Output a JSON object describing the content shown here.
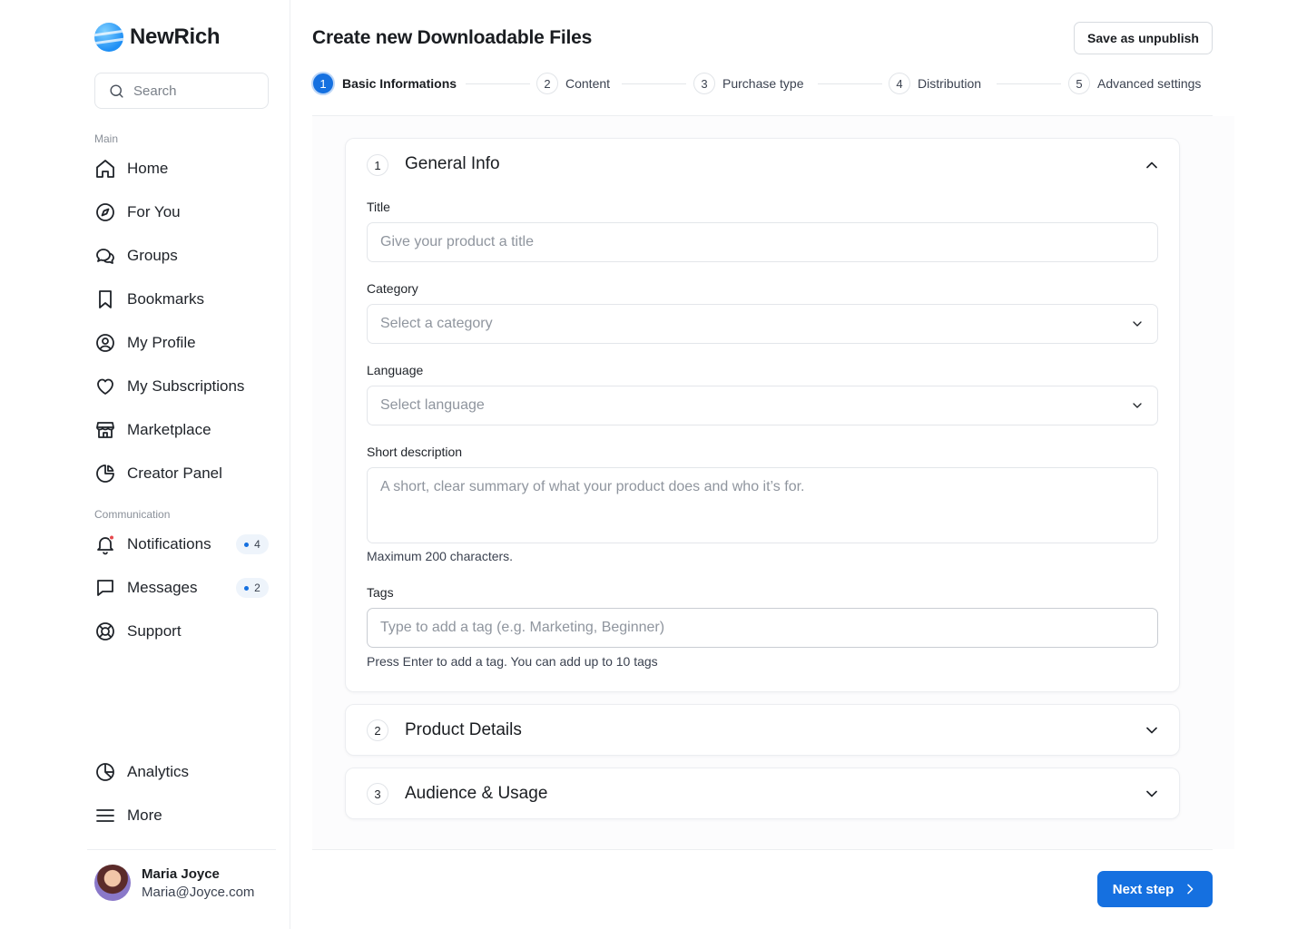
{
  "app": {
    "name": "NewRich"
  },
  "search": {
    "placeholder": "Search"
  },
  "sidebar": {
    "main_label": "Main",
    "main_items": [
      {
        "label": "Home",
        "icon": "home-icon"
      },
      {
        "label": "For You",
        "icon": "compass-icon"
      },
      {
        "label": "Groups",
        "icon": "chat-bubbles-icon"
      },
      {
        "label": "Bookmarks",
        "icon": "bookmark-icon"
      },
      {
        "label": "My Profile",
        "icon": "user-circle-icon"
      },
      {
        "label": "My Subscriptions",
        "icon": "heart-icon"
      },
      {
        "label": "Marketplace",
        "icon": "store-icon"
      },
      {
        "label": "Creator Panel",
        "icon": "pie-chart-icon"
      }
    ],
    "communication_label": "Communication",
    "communication_items": [
      {
        "label": "Notifications",
        "icon": "bell-icon",
        "badge": "4"
      },
      {
        "label": "Messages",
        "icon": "message-icon",
        "badge": "2"
      },
      {
        "label": "Support",
        "icon": "lifebuoy-icon"
      }
    ],
    "bottom_items": [
      {
        "label": "Analytics",
        "icon": "analytics-icon"
      },
      {
        "label": "More",
        "icon": "menu-icon"
      }
    ]
  },
  "user": {
    "name": "Maria Joyce",
    "email": "Maria@Joyce.com"
  },
  "header": {
    "title": "Create new Downloadable Files",
    "save_label": "Save as unpublish"
  },
  "steps": [
    {
      "num": "1",
      "label": "Basic Informations",
      "active": true
    },
    {
      "num": "2",
      "label": "Content"
    },
    {
      "num": "3",
      "label": "Purchase type"
    },
    {
      "num": "4",
      "label": "Distribution"
    },
    {
      "num": "5",
      "label": "Advanced settings"
    }
  ],
  "general_info": {
    "num": "1",
    "title": "General Info",
    "title_label": "Title",
    "title_placeholder": "Give your product a title",
    "category_label": "Category",
    "category_placeholder": "Select a category",
    "language_label": "Language",
    "language_placeholder": "Select language",
    "short_desc_label": "Short description",
    "short_desc_placeholder": "A short, clear summary of what your product does and who it’s for.",
    "short_desc_hint": "Maximum 200 characters.",
    "tags_label": "Tags",
    "tags_placeholder": "Type to add a tag (e.g. Marketing, Beginner)",
    "tags_hint": "Press Enter to add a tag. You can add up to 10 tags"
  },
  "product_details": {
    "num": "2",
    "title": "Product Details"
  },
  "audience_usage": {
    "num": "3",
    "title": "Audience & Usage"
  },
  "footer": {
    "next_label": "Next step"
  },
  "colors": {
    "primary": "#1570e0",
    "badge_dot": "#1570e0",
    "notification_dot": "#e5484d"
  }
}
